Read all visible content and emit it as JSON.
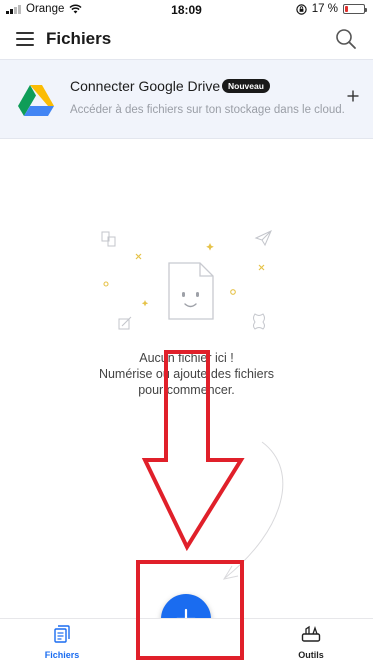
{
  "status_bar": {
    "carrier": "Orange",
    "time": "18:09",
    "battery_percent": "17 %",
    "battery_level": 0.17
  },
  "header": {
    "title": "Fichiers"
  },
  "banner": {
    "title": "Connecter Google Drive",
    "badge": "Nouveau",
    "subtitle": "Accéder à des fichiers sur ton stockage dans le cloud."
  },
  "empty_state": {
    "line1": "Aucun fichier ici !",
    "line2": "Numérise ou ajoute des fichiers",
    "line3": "pour commencer."
  },
  "tabs": {
    "files_label": "Fichiers",
    "tools_label": "Outils"
  },
  "colors": {
    "accent": "#1a6cf0",
    "annotation": "#e0202a",
    "banner_bg": "#f1f4fb",
    "badge_bg": "#1a1a1a"
  }
}
